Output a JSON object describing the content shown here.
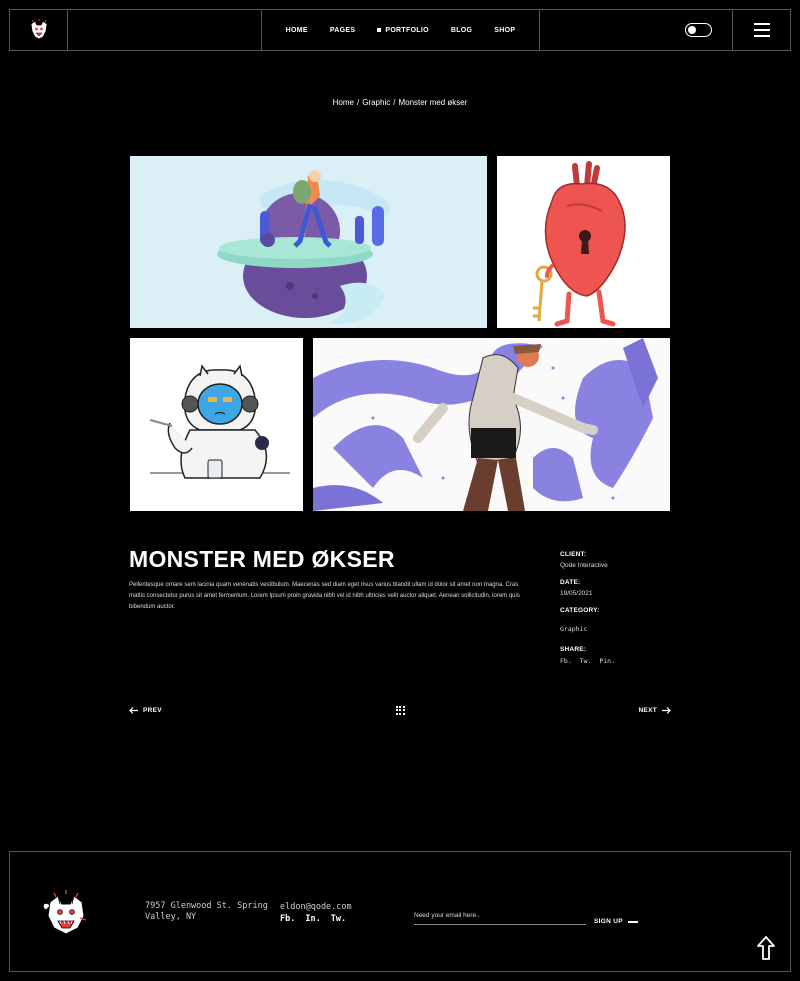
{
  "header": {
    "nav": [
      {
        "label": "HOME",
        "active": false
      },
      {
        "label": "PAGES",
        "active": false
      },
      {
        "label": "PORTFOLIO",
        "active": true
      },
      {
        "label": "BLOG",
        "active": false
      },
      {
        "label": "SHOP",
        "active": false
      }
    ],
    "theme_toggle": "dark-mode-toggle",
    "menu_icon": "hamburger-icon"
  },
  "breadcrumb": {
    "items": [
      "Home",
      "Graphic",
      "Monster med økser"
    ],
    "separator": "/"
  },
  "gallery": {
    "tiles": [
      {
        "subject": "floating-island-illustration"
      },
      {
        "subject": "heart-with-key-illustration"
      },
      {
        "subject": "astronaut-cat-illustration"
      },
      {
        "subject": "man-with-hands-illustration"
      }
    ]
  },
  "project": {
    "title": "MONSTER MED ØKSER",
    "description": "Pellentesque ornare sem lacinia quam venenatis vestibulum. Maecenas sed diam eget risus varius blandit ullam id dolor sit amet non magna. Cras mattis consectetur purus sit amet fermentum. Lorem Ipsum proin gravida nibh vel id nibh ultricies velit auctor aliquet. Aenean sollicitudin, lorem quis bibendum auctor.",
    "meta": {
      "client_label": "CLIENT:",
      "client": "Qode Interactive",
      "date_label": "DATE:",
      "date": "19/05/2021",
      "category_label": "CATEGORY:",
      "category": "Graphic",
      "share_label": "SHARE:",
      "share": [
        "Fb.",
        "Tw.",
        "Pin."
      ]
    }
  },
  "pager": {
    "prev": "PREV",
    "next": "NEXT"
  },
  "footer": {
    "address": "7957 Glenwood St. Spring Valley, NY",
    "email": "eldon@qode.com",
    "social": [
      "Fb.",
      "In.",
      "Tw."
    ],
    "newsletter_placeholder": "Need your email here..",
    "signup": "SIGN UP"
  },
  "colors": {
    "background": "#000000",
    "border": "#555555",
    "text": "#ffffff",
    "accent_purple": "#8a82e0",
    "accent_red": "#ee5550"
  }
}
